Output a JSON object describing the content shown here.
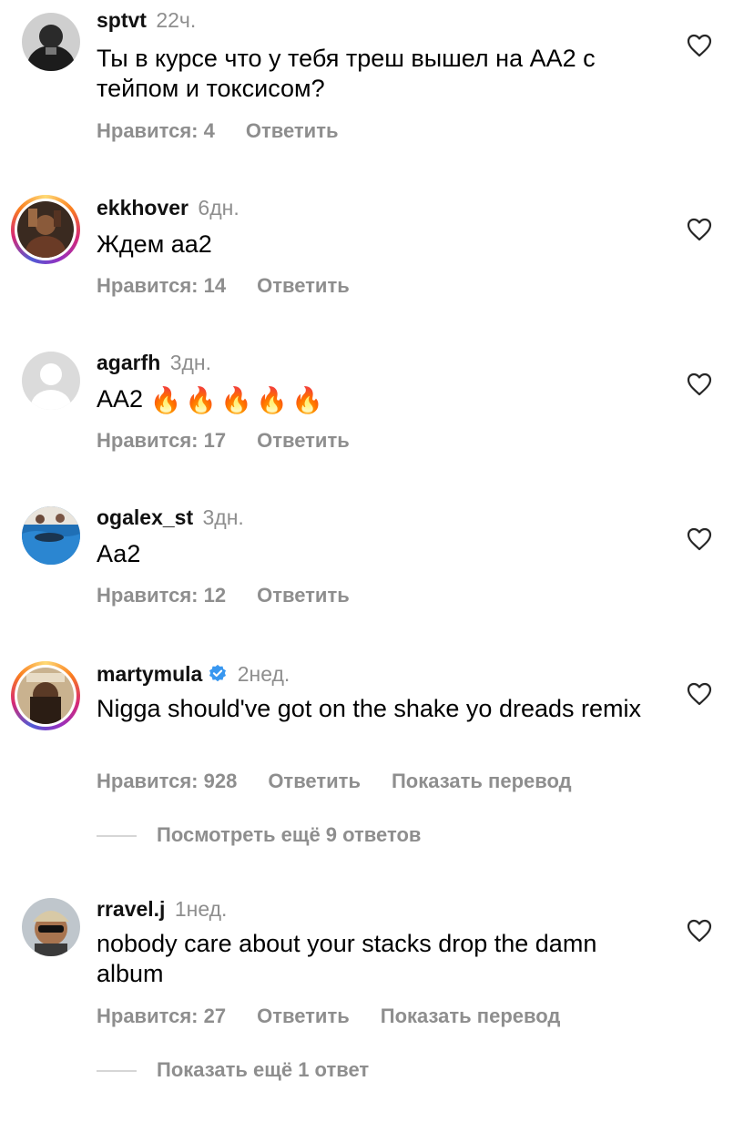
{
  "comments": [
    {
      "username": "sptvt",
      "time": "22ч.",
      "text": "Ты в курсе что у тебя треш вышел на АА2 с тейпом и токсисом?",
      "likes": "Нравится: 4",
      "reply": "Ответить"
    },
    {
      "username": "ekkhover",
      "time": "6дн.",
      "text": "Ждем аа2",
      "likes": "Нравится: 14",
      "reply": "Ответить"
    },
    {
      "username": "agarfh",
      "time": "3дн.",
      "text": "АА2",
      "emoji": "🔥🔥🔥🔥🔥",
      "likes": "Нравится: 17",
      "reply": "Ответить"
    },
    {
      "username": "ogalex_st",
      "time": "3дн.",
      "text": "Аа2",
      "likes": "Нравится: 12",
      "reply": "Ответить"
    },
    {
      "username": "martymula",
      "time": "2нед.",
      "text": "Nigga should've got on the shake yo dreads remix",
      "likes": "Нравится: 928",
      "reply": "Ответить",
      "translate": "Показать перевод",
      "more_replies": "Посмотреть ещё 9 ответов"
    },
    {
      "username": "rravel.j",
      "time": "1нед.",
      "text": "nobody care about your stacks drop the damn album",
      "likes": "Нравится: 27",
      "reply": "Ответить",
      "translate": "Показать перевод",
      "more_replies": "Показать ещё 1 ответ"
    }
  ],
  "colors": {
    "muted": "#8e8e8e",
    "verified": "#3897f0",
    "fire": "#f46a1b"
  }
}
